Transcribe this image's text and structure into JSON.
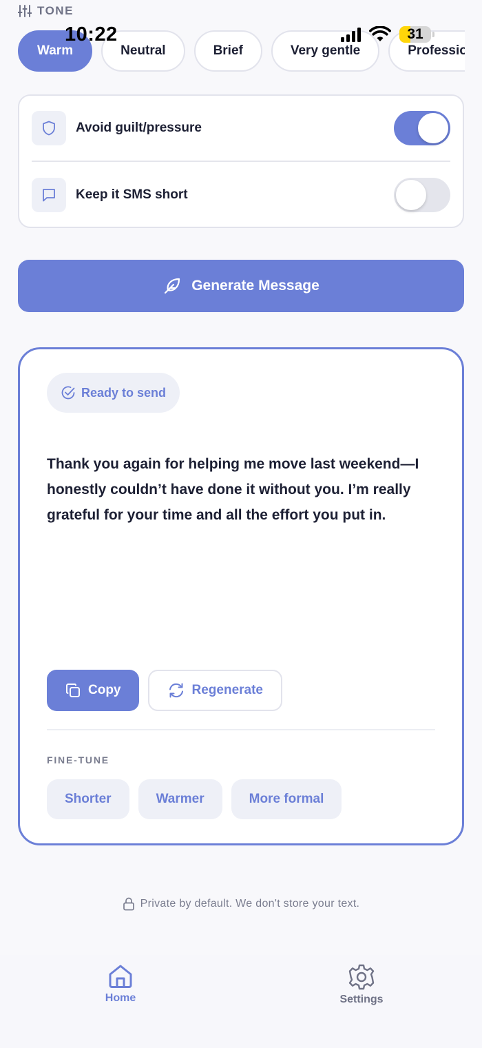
{
  "status_bar": {
    "time": "10:22",
    "battery": "31"
  },
  "tone": {
    "label": "TONE",
    "options": [
      "Warm",
      "Neutral",
      "Brief",
      "Very gentle",
      "Professional"
    ],
    "selected": "Warm"
  },
  "toggles": [
    {
      "label": "Avoid guilt/pressure",
      "icon": "shield-icon",
      "on": true
    },
    {
      "label": "Keep it SMS short",
      "icon": "chat-bubble-icon",
      "on": false
    }
  ],
  "generate": {
    "label": "Generate Message",
    "icon": "feather-icon"
  },
  "result": {
    "status": "Ready to send",
    "message": "Thank you again for helping me move last weekend—I honestly couldn’t have done it without you. I’m really grateful for your time and all the effort you put in.",
    "copy_label": "Copy",
    "regenerate_label": "Regenerate",
    "finetune_label": "FINE-TUNE",
    "finetune_options": [
      "Shorter",
      "Warmer",
      "More formal"
    ]
  },
  "privacy_note": "Private by default. We don't store your text.",
  "tabs": [
    {
      "label": "Home",
      "icon": "home-icon",
      "active": true
    },
    {
      "label": "Settings",
      "icon": "gear-icon",
      "active": false
    }
  ],
  "colors": {
    "accent": "#6b7fd7",
    "background": "#f8f8fb",
    "text": "#1c1f33",
    "muted": "#7a7d8f"
  }
}
